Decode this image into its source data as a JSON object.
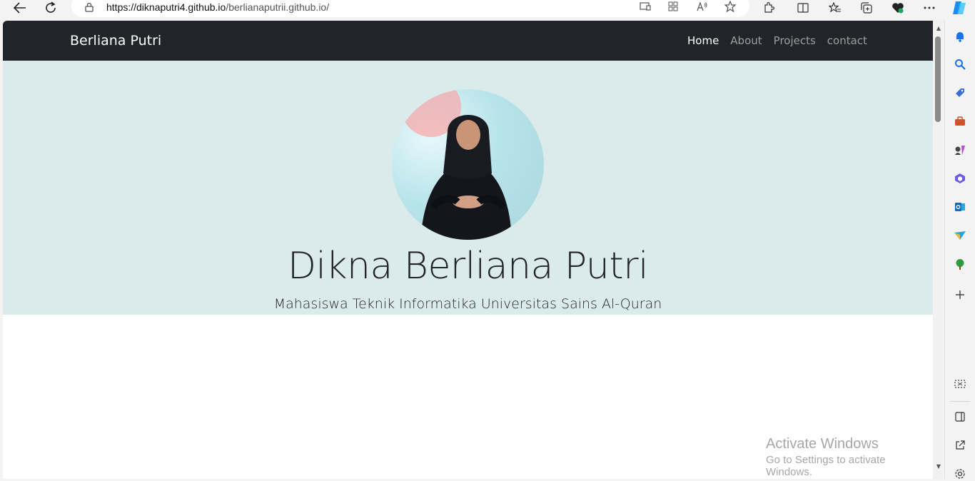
{
  "browser": {
    "url_domain": "https://diknaputri4.github.io",
    "url_path": "/berlianaputrii.github.io/"
  },
  "site": {
    "brand": "Berliana Putri",
    "nav": [
      {
        "label": "Home",
        "active": true
      },
      {
        "label": "About",
        "active": false
      },
      {
        "label": "Projects",
        "active": false
      },
      {
        "label": "contact",
        "active": false
      }
    ]
  },
  "hero": {
    "title": "Dikna Berliana Putri",
    "subtitle": "Mahasiswa Teknik Informatika Universitas Sains Al-Quran"
  },
  "watermark": {
    "line1": "Activate Windows",
    "line2": "Go to Settings to activate Windows."
  },
  "colors": {
    "navbar_bg": "#212529",
    "hero_bg": "#dbeaeb"
  },
  "icons": [
    "back-icon",
    "refresh-icon",
    "lock-icon",
    "cast-icon",
    "apps-icon",
    "read-aloud-icon",
    "favorite-star-icon",
    "extensions-icon",
    "split-screen-icon",
    "favorites-icon",
    "collections-icon",
    "browser-essentials-icon",
    "more-icon",
    "copilot-icon",
    "bell-icon",
    "search-icon",
    "tag-icon",
    "toolbox-icon",
    "games-icon",
    "office-icon",
    "outlook-icon",
    "send-icon",
    "tree-icon",
    "add-icon",
    "screenshot-icon",
    "sidebar-panel-icon",
    "external-link-icon",
    "settings-icon"
  ]
}
